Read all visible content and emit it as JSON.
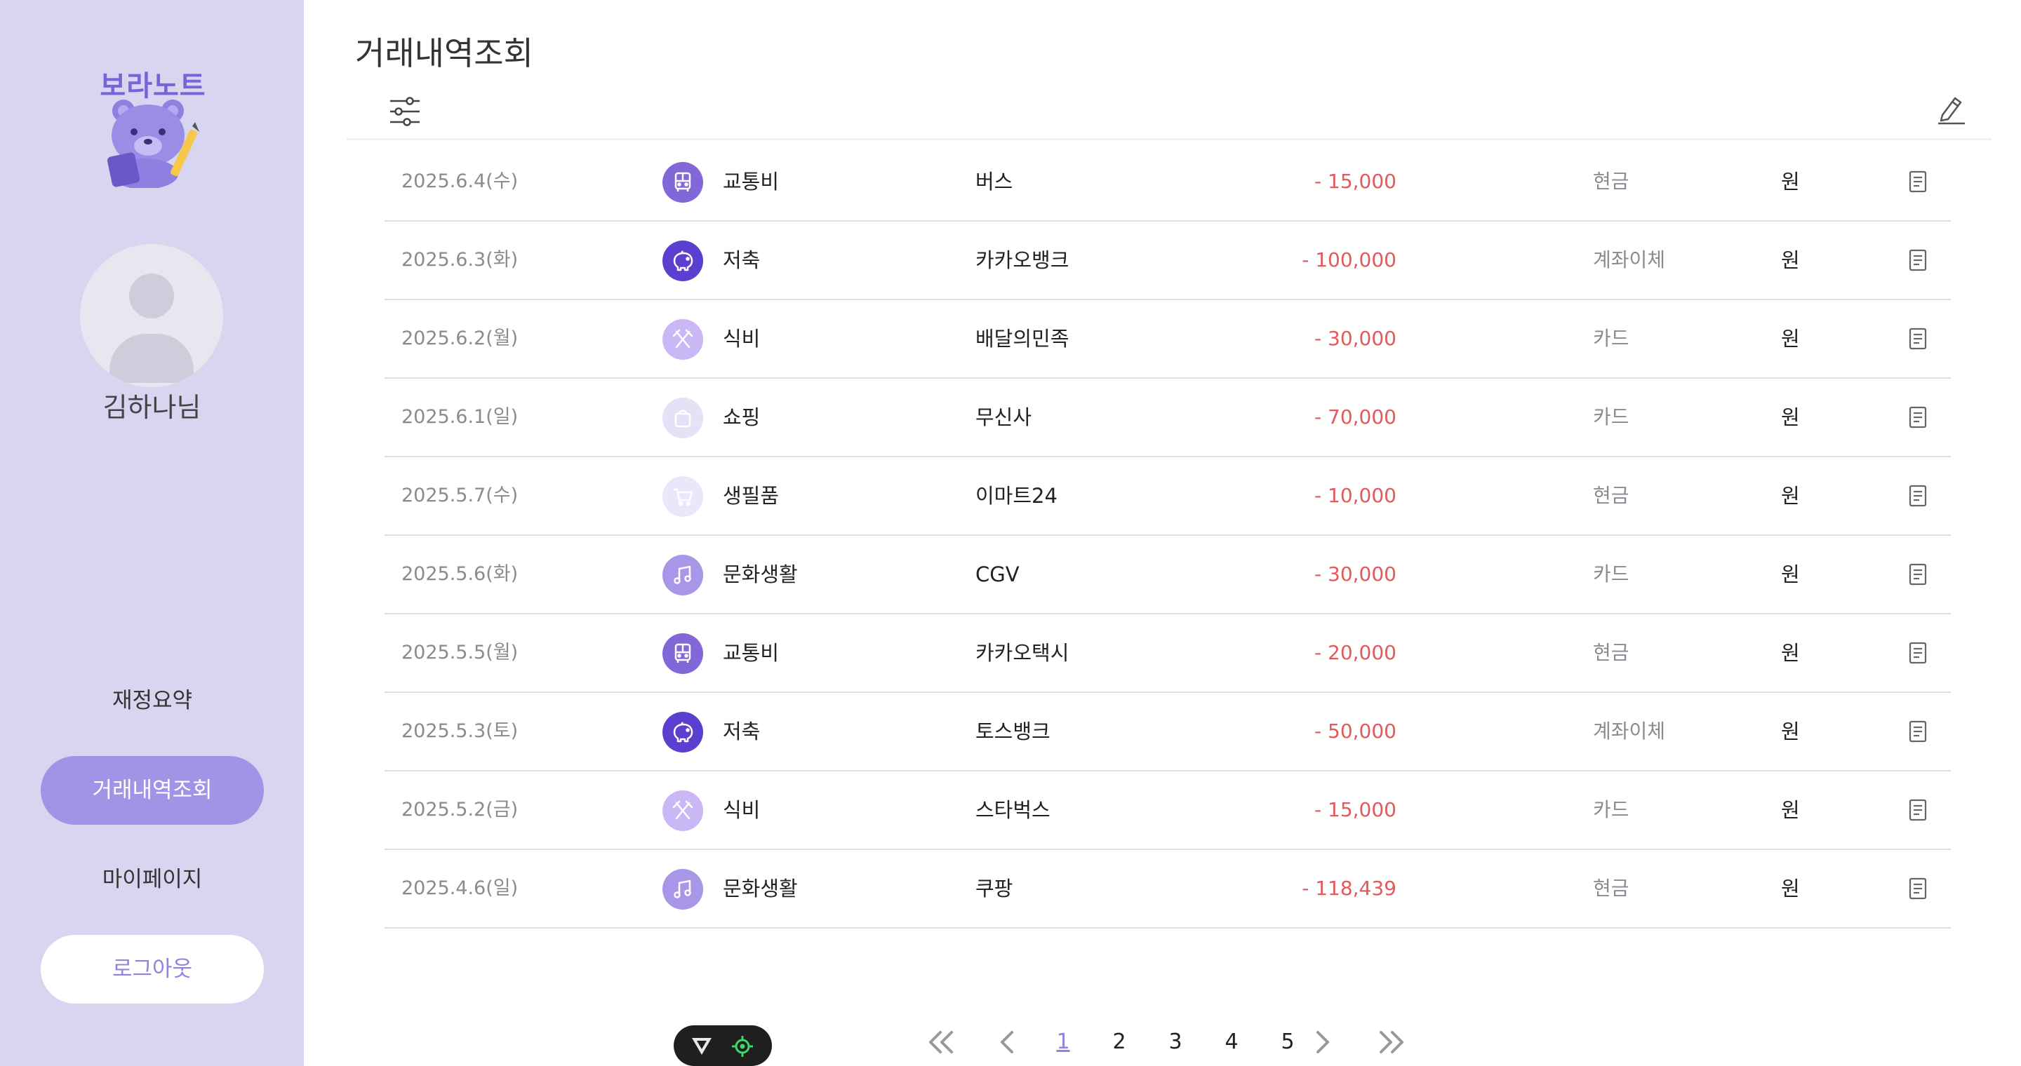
{
  "page_title": "거래내역조회",
  "sidebar": {
    "logo_text": "보라노트",
    "username": "김하나님",
    "nav": {
      "summary": "재정요약",
      "history": "거래내역조회",
      "mypage": "마이페이지",
      "logout": "로그아웃"
    }
  },
  "transactions": [
    {
      "date": "2025.6.4(수)",
      "category": "교통비",
      "icon": "bus-icon",
      "icon_color": "#8267d8",
      "merchant": "버스",
      "method": "현금",
      "amount": "- 15,000",
      "unit": "원"
    },
    {
      "date": "2025.6.3(화)",
      "category": "저축",
      "icon": "piggy-bank-icon",
      "icon_color": "#5a3fd0",
      "merchant": "카카오뱅크",
      "method": "계좌이체",
      "amount": "- 100,000",
      "unit": "원"
    },
    {
      "date": "2025.6.2(월)",
      "category": "식비",
      "icon": "utensils-icon",
      "icon_color": "#c9b8f5",
      "merchant": "배달의민족",
      "method": "카드",
      "amount": "- 30,000",
      "unit": "원"
    },
    {
      "date": "2025.6.1(일)",
      "category": "쇼핑",
      "icon": "shopping-bag-icon",
      "icon_color": "#e6e1f7",
      "merchant": "무신사",
      "method": "카드",
      "amount": "- 70,000",
      "unit": "원"
    },
    {
      "date": "2025.5.7(수)",
      "category": "생필품",
      "icon": "cart-icon",
      "icon_color": "#ebe7fb",
      "merchant": "이마트24",
      "method": "현금",
      "amount": "- 10,000",
      "unit": "원"
    },
    {
      "date": "2025.5.6(화)",
      "category": "문화생활",
      "icon": "music-icon",
      "icon_color": "#a897e8",
      "merchant": "CGV",
      "method": "카드",
      "amount": "- 30,000",
      "unit": "원"
    },
    {
      "date": "2025.5.5(월)",
      "category": "교통비",
      "icon": "bus-icon",
      "icon_color": "#8267d8",
      "merchant": "카카오택시",
      "method": "현금",
      "amount": "- 20,000",
      "unit": "원"
    },
    {
      "date": "2025.5.3(토)",
      "category": "저축",
      "icon": "piggy-bank-icon",
      "icon_color": "#5a3fd0",
      "merchant": "토스뱅크",
      "method": "계좌이체",
      "amount": "- 50,000",
      "unit": "원"
    },
    {
      "date": "2025.5.2(금)",
      "category": "식비",
      "icon": "utensils-icon",
      "icon_color": "#c9b8f5",
      "merchant": "스타벅스",
      "method": "카드",
      "amount": "- 15,000",
      "unit": "원"
    },
    {
      "date": "2025.4.6(일)",
      "category": "문화생활",
      "icon": "music-icon",
      "icon_color": "#a897e8",
      "merchant": "쿠팡",
      "method": "현금",
      "amount": "- 118,439",
      "unit": "원"
    }
  ],
  "pagination": {
    "pages": [
      "1",
      "2",
      "3",
      "4",
      "5"
    ],
    "current": "1"
  },
  "colors": {
    "sidebar_bg": "#d8d5f0",
    "accent": "#9f94e6",
    "amount_negative": "#e25a5a"
  }
}
